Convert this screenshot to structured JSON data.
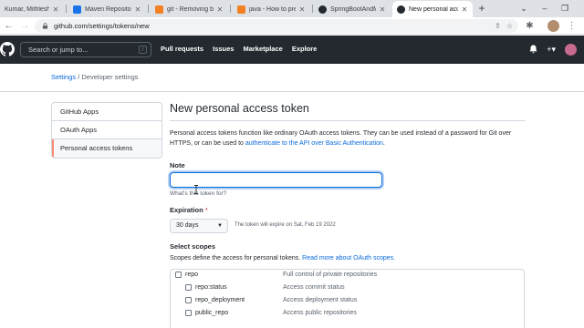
{
  "browser": {
    "tabs": [
      {
        "title": "Kumar, Mithlesh - Ou",
        "favicon": "mail-icon",
        "color": "#0072c6"
      },
      {
        "title": "Maven Repository: jun",
        "favicon": "maven-icon",
        "color": "#1a73e8"
      },
      {
        "title": "git - Removing bin",
        "favicon": "stackoverflow-icon",
        "color": "#f48024"
      },
      {
        "title": "java - How to prev",
        "favicon": "stackoverflow-icon",
        "color": "#f48024"
      },
      {
        "title": "SpringBootAndMic",
        "favicon": "github-icon",
        "color": "#24292f"
      },
      {
        "title": "New personal acce",
        "favicon": "github-icon",
        "color": "#24292f",
        "active": true
      }
    ],
    "url": "github.com/settings/tokens/new"
  },
  "header": {
    "search_placeholder": "Search or jump to...",
    "search_shortcut": "/",
    "nav": [
      "Pull requests",
      "Issues",
      "Marketplace",
      "Explore"
    ]
  },
  "breadcrumb": {
    "settings": "Settings",
    "separator": "/",
    "current": "Developer settings"
  },
  "sidebar": {
    "items": [
      {
        "label": "GitHub Apps"
      },
      {
        "label": "OAuth Apps"
      },
      {
        "label": "Personal access tokens",
        "selected": true
      }
    ]
  },
  "main": {
    "title": "New personal access token",
    "intro_text": "Personal access tokens function like ordinary OAuth access tokens. They can be used instead of a password for Git over HTTPS, or can be used to ",
    "intro_link": "authenticate to the API over Basic Authentication",
    "intro_end": ".",
    "note_label": "Note",
    "note_value": "",
    "note_hint": "What's this token for?",
    "expiration_label": "Expiration",
    "required_mark": "*",
    "expiration_value": "30 days",
    "expiration_note": "The token will expire on Sat, Feb 19 2022",
    "scopes_label": "Select scopes",
    "scopes_desc": "Scopes define the access for personal tokens. ",
    "scopes_link": "Read more about OAuth scopes.",
    "scopes": [
      {
        "name": "repo",
        "desc": "Full control of private repositories",
        "level": 0
      },
      {
        "name": "repo:status",
        "desc": "Access commit status",
        "level": 1
      },
      {
        "name": "repo_deployment",
        "desc": "Access deployment status",
        "level": 1
      },
      {
        "name": "public_repo",
        "desc": "Access public repositories",
        "level": 1
      }
    ]
  }
}
